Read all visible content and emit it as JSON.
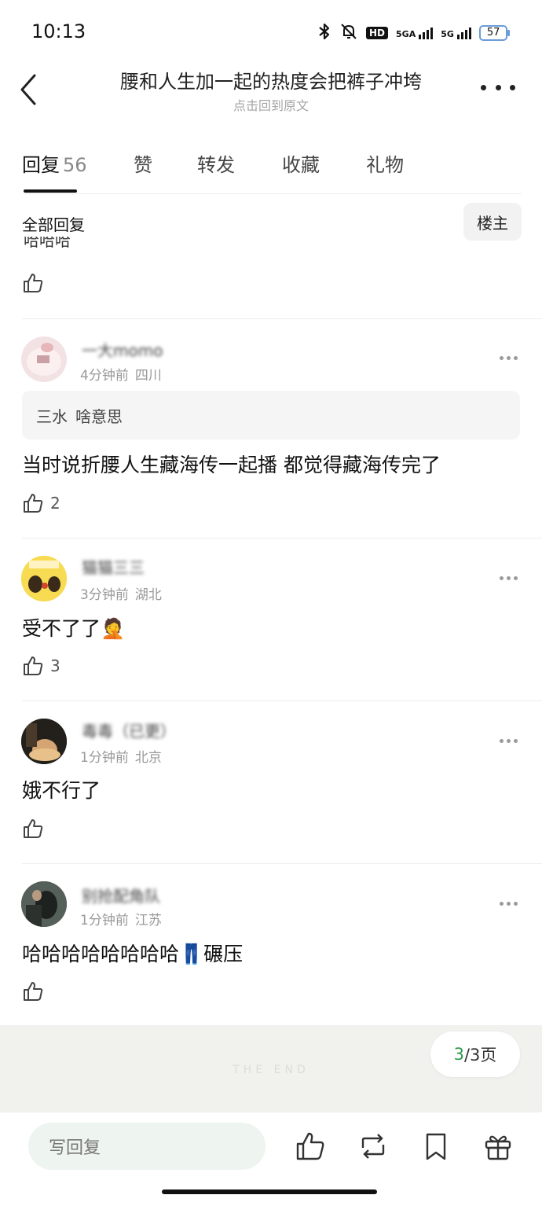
{
  "status_bar": {
    "time": "10:13",
    "hd_label": "HD",
    "signal1_label": "5GA",
    "signal2_label": "5G",
    "battery": "57",
    "icons": [
      "bluetooth-icon",
      "mute-bell-icon",
      "hd-icon",
      "signal-icon",
      "signal-icon",
      "battery-icon"
    ]
  },
  "header": {
    "title": "腰和人生加一起的热度会把裤子冲垮",
    "subtitle": "点击回到原文"
  },
  "tabs": [
    {
      "label": "回复",
      "count": "56"
    },
    {
      "label": "赞"
    },
    {
      "label": "转发"
    },
    {
      "label": "收藏"
    },
    {
      "label": "礼物"
    }
  ],
  "filter": {
    "all_label": "全部回复",
    "op_label": "楼主"
  },
  "partial_comment": {
    "text": "哈哈哈"
  },
  "comments": [
    {
      "username": "一大momo",
      "time": "4分钟前",
      "location": "四川",
      "quote_name": "三水",
      "quote_text": "啥意思",
      "text": "当时说折腰人生藏海传一起播 都觉得藏海传完了",
      "likes": "2"
    },
    {
      "username": "猫猫三三",
      "time": "3分钟前",
      "location": "湖北",
      "text": "受不了了🤦",
      "likes": "3"
    },
    {
      "username": "毒毒（已更）",
      "time": "1分钟前",
      "location": "北京",
      "text": "娥不行了",
      "likes": ""
    },
    {
      "username": "别抢配角队",
      "time": "1分钟前",
      "location": "江苏",
      "text": "哈哈哈哈哈哈哈哈👖碾压",
      "likes": ""
    }
  ],
  "end": {
    "label": "THE END",
    "page_current": "3",
    "page_total": "/3页"
  },
  "bottom_bar": {
    "reply_placeholder": "写回复",
    "icons": [
      "like-icon",
      "repost-icon",
      "bookmark-icon",
      "gift-icon"
    ]
  }
}
